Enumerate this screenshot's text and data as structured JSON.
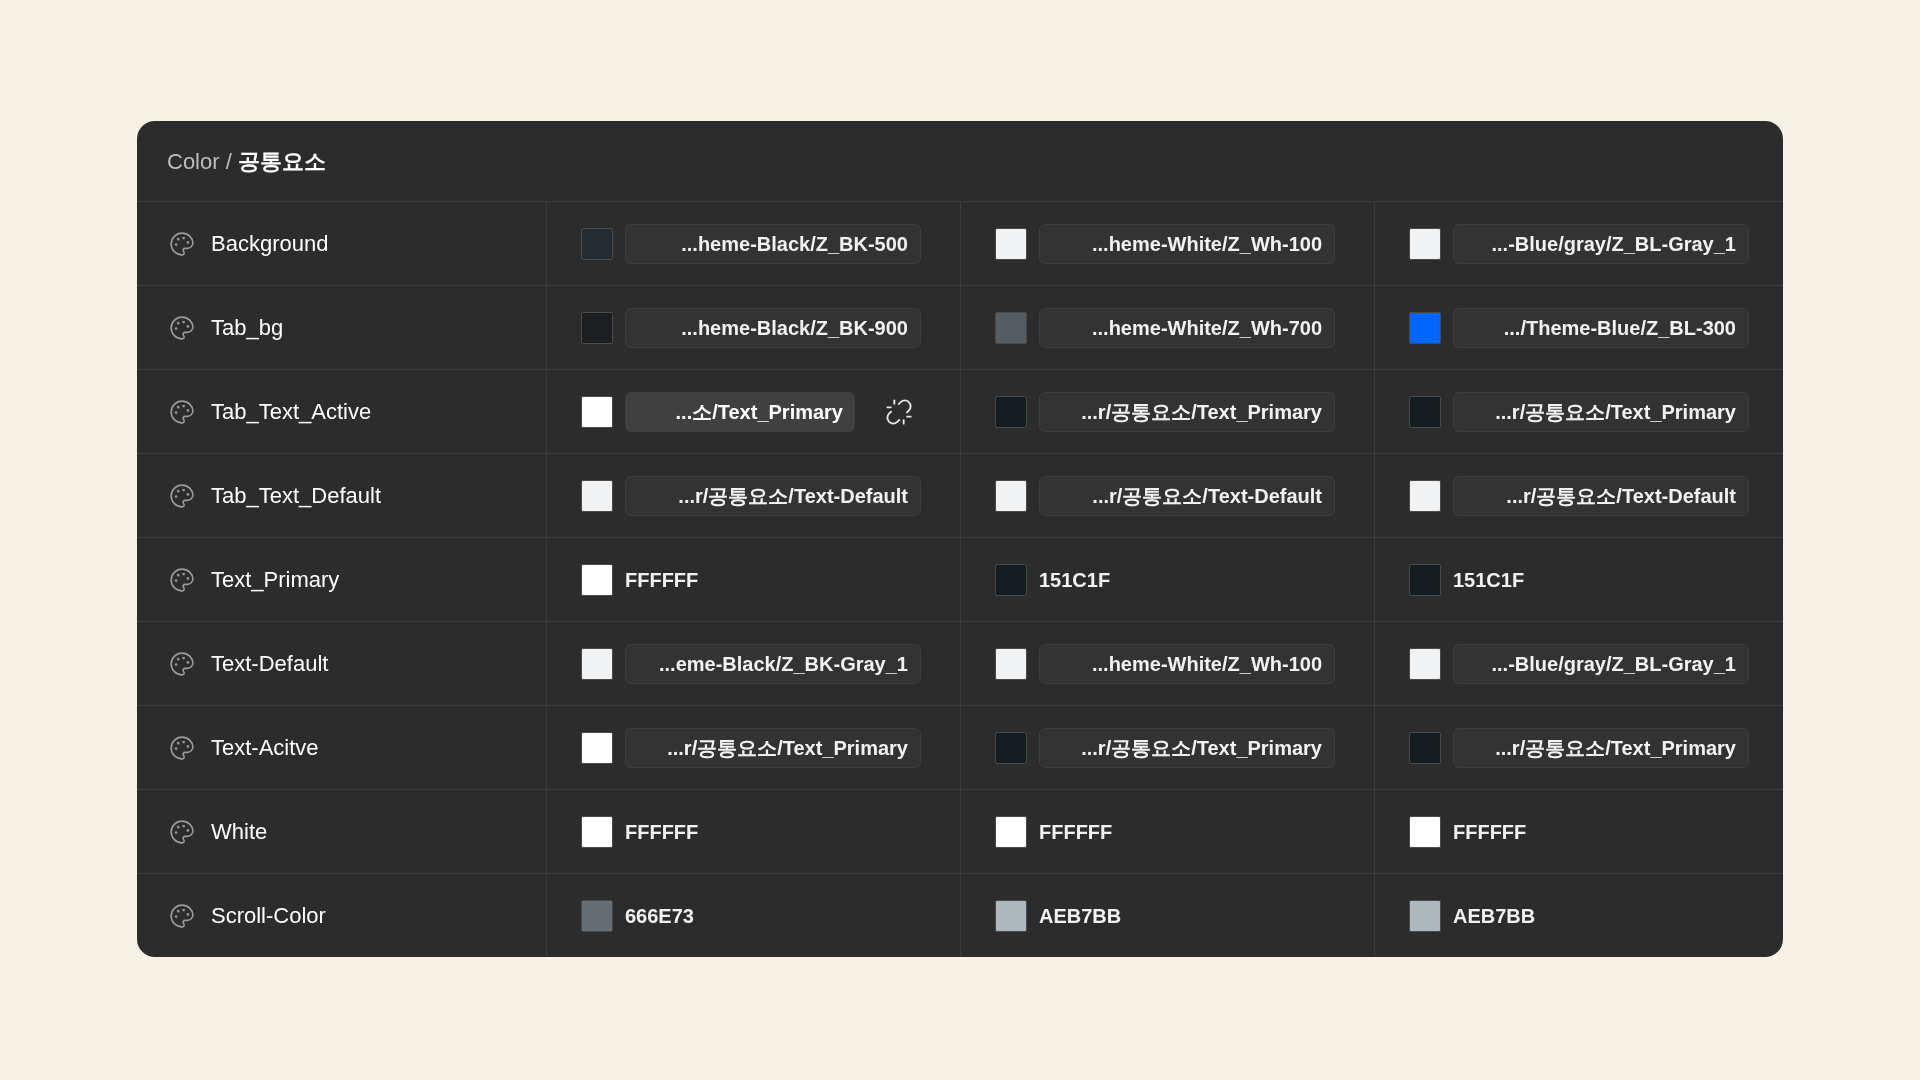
{
  "header": {
    "path": "Color /",
    "current": "공통요소"
  },
  "rows": [
    {
      "name": "Background",
      "values": [
        {
          "kind": "alias",
          "color": "#262b2f",
          "text": "...heme-Black/Z_BK-500",
          "hovered": false
        },
        {
          "kind": "alias",
          "color": "#f1f2f4",
          "text": "...heme-White/Z_Wh-100",
          "hovered": false
        },
        {
          "kind": "alias",
          "color": "#f1f2f4",
          "text": "...-Blue/gray/Z_BL-Gray_1",
          "hovered": false
        }
      ]
    },
    {
      "name": "Tab_bg",
      "values": [
        {
          "kind": "alias",
          "color": "#1b1f22",
          "text": "...heme-Black/Z_BK-900",
          "hovered": false
        },
        {
          "kind": "alias",
          "color": "#555c62",
          "text": "...heme-White/Z_Wh-700",
          "hovered": false
        },
        {
          "kind": "alias",
          "color": "#0066ff",
          "text": ".../Theme-Blue/Z_BL-300",
          "hovered": false
        }
      ]
    },
    {
      "name": "Tab_Text_Active",
      "values": [
        {
          "kind": "alias",
          "color": "#ffffff",
          "text": "...소/Text_Primary",
          "hovered": true
        },
        {
          "kind": "alias",
          "color": "#151c1f",
          "text": "...r/공통요소/Text_Primary",
          "hovered": false
        },
        {
          "kind": "alias",
          "color": "#151c1f",
          "text": "...r/공통요소/Text_Primary",
          "hovered": false
        }
      ]
    },
    {
      "name": "Tab_Text_Default",
      "values": [
        {
          "kind": "alias",
          "color": "#f1f2f4",
          "text": "...r/공통요소/Text-Default",
          "hovered": false
        },
        {
          "kind": "alias",
          "color": "#f1f2f4",
          "text": "...r/공통요소/Text-Default",
          "hovered": false
        },
        {
          "kind": "alias",
          "color": "#f1f2f4",
          "text": "...r/공통요소/Text-Default",
          "hovered": false
        }
      ]
    },
    {
      "name": "Text_Primary",
      "values": [
        {
          "kind": "hex",
          "color": "#ffffff",
          "text": "FFFFFF"
        },
        {
          "kind": "hex",
          "color": "#151c1f",
          "text": "151C1F"
        },
        {
          "kind": "hex",
          "color": "#151c1f",
          "text": "151C1F"
        }
      ]
    },
    {
      "name": "Text-Default",
      "values": [
        {
          "kind": "alias",
          "color": "#f1f2f4",
          "text": "...eme-Black/Z_BK-Gray_1",
          "hovered": false
        },
        {
          "kind": "alias",
          "color": "#f1f2f4",
          "text": "...heme-White/Z_Wh-100",
          "hovered": false
        },
        {
          "kind": "alias",
          "color": "#f1f2f4",
          "text": "...-Blue/gray/Z_BL-Gray_1",
          "hovered": false
        }
      ]
    },
    {
      "name": "Text-Acitve",
      "values": [
        {
          "kind": "alias",
          "color": "#ffffff",
          "text": "...r/공통요소/Text_Primary",
          "hovered": false
        },
        {
          "kind": "alias",
          "color": "#151c1f",
          "text": "...r/공통요소/Text_Primary",
          "hovered": false
        },
        {
          "kind": "alias",
          "color": "#151c1f",
          "text": "...r/공통요소/Text_Primary",
          "hovered": false
        }
      ]
    },
    {
      "name": "White",
      "values": [
        {
          "kind": "hex",
          "color": "#ffffff",
          "text": "FFFFFF"
        },
        {
          "kind": "hex",
          "color": "#ffffff",
          "text": "FFFFFF"
        },
        {
          "kind": "hex",
          "color": "#ffffff",
          "text": "FFFFFF"
        }
      ]
    },
    {
      "name": "Scroll-Color",
      "values": [
        {
          "kind": "hex",
          "color": "#666e73",
          "text": "666E73"
        },
        {
          "kind": "hex",
          "color": "#aeb7bb",
          "text": "AEB7BB"
        },
        {
          "kind": "hex",
          "color": "#aeb7bb",
          "text": "AEB7BB"
        }
      ]
    }
  ]
}
